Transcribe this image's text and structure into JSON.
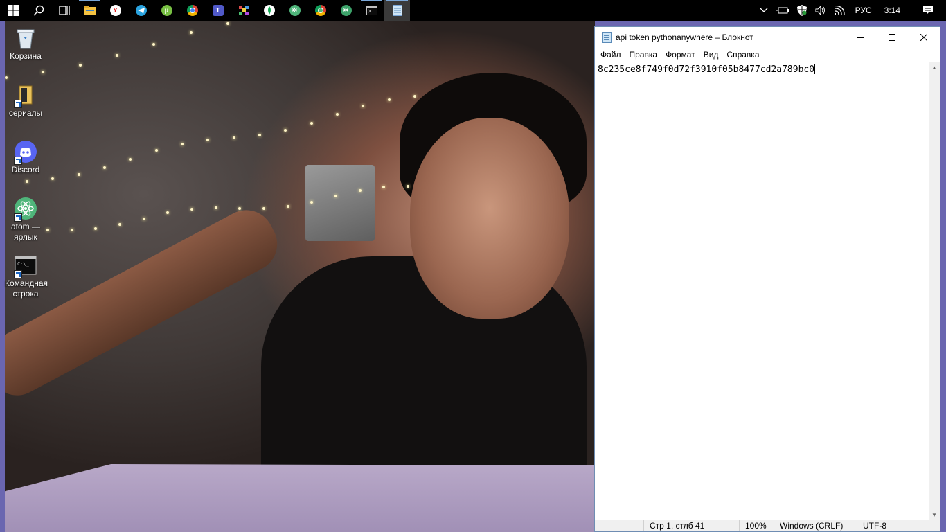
{
  "taskbar": {
    "apps": [
      {
        "name": "start-button-icon"
      },
      {
        "name": "search-icon"
      },
      {
        "name": "task-view-icon"
      },
      {
        "name": "file-explorer-icon"
      },
      {
        "name": "yandex-browser-icon"
      },
      {
        "name": "telegram-icon"
      },
      {
        "name": "utorrent-icon"
      },
      {
        "name": "chrome-icon"
      },
      {
        "name": "teams-icon"
      },
      {
        "name": "pixel-app-icon"
      },
      {
        "name": "mongodb-compass-icon"
      },
      {
        "name": "atom-icon"
      },
      {
        "name": "chrome-profile-icon"
      },
      {
        "name": "atom-green-icon"
      },
      {
        "name": "command-prompt-icon"
      },
      {
        "name": "notepad-icon"
      }
    ],
    "tray": {
      "language": "РУС",
      "time": "3:14"
    }
  },
  "desktop": {
    "icons": [
      {
        "label": "Корзина"
      },
      {
        "label": "сериалы"
      },
      {
        "label": "Discord"
      },
      {
        "label": "atom — ярлык"
      },
      {
        "label": "Командная строка"
      }
    ]
  },
  "notepad": {
    "title": "api token pythonanywhere – Блокнот",
    "menu": [
      "Файл",
      "Правка",
      "Формат",
      "Вид",
      "Справка"
    ],
    "content": "8c235ce8f749f0d72f3910f05b8477cd2a789bc0",
    "status": {
      "position": "Стр 1, стлб 41",
      "zoom": "100%",
      "line_endings": "Windows (CRLF)",
      "encoding": "UTF-8"
    }
  }
}
